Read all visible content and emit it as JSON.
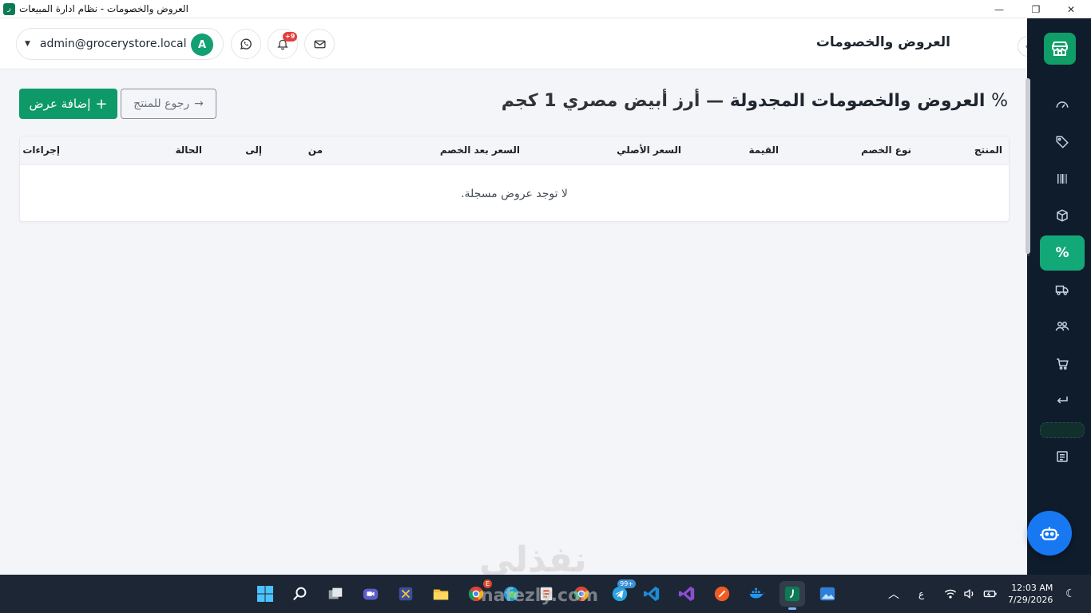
{
  "window": {
    "title": "العروض والخصومات - نظام ادارة المبيعات",
    "app_icon": "ر",
    "controls": {
      "minimize": "—",
      "restore": "❐",
      "close": "✕"
    }
  },
  "header": {
    "title": "العروض والخصومات",
    "user_email": "admin@grocerystore.local",
    "avatar_letter": "A",
    "notifications_badge": "+9"
  },
  "page": {
    "heading_icon": "%",
    "heading_main": "العروض والخصومات المجدولة",
    "heading_separator": "—",
    "heading_product": "أرز أبيض مصري 1 كجم",
    "add_button": "إضافة عرض",
    "add_icon": "+",
    "back_button": "رجوع للمنتج",
    "back_icon": "→"
  },
  "table": {
    "columns": [
      "المنتج",
      "نوع الخصم",
      "القيمة",
      "السعر الأصلي",
      "السعر بعد الخصم",
      "من",
      "إلى",
      "الحالة",
      "إجراءات"
    ],
    "empty_message": "لا توجد عروض مسجلة."
  },
  "sidebar": {
    "items": [
      {
        "icon": "dashboard-gauge-icon"
      },
      {
        "icon": "tags-icon"
      },
      {
        "icon": "barcode-icon"
      },
      {
        "icon": "box-icon"
      },
      {
        "icon": "percent-icon",
        "active": true
      },
      {
        "icon": "truck-icon"
      },
      {
        "icon": "users-icon"
      },
      {
        "icon": "cart-icon"
      },
      {
        "icon": "return-arrow-icon"
      },
      {
        "icon": "placeholder-slot"
      },
      {
        "icon": "report-icon"
      }
    ],
    "active_color": "#13a877",
    "bg_color": "#0f1c2c"
  },
  "watermark": {
    "arabic": "نفذلي",
    "latin": "nafezly.com"
  },
  "taskbar": {
    "lang": "ع",
    "time": "12:03 AM",
    "date": "7/29/2026",
    "telegram_badge": "99+",
    "chrome_badge": "E"
  }
}
